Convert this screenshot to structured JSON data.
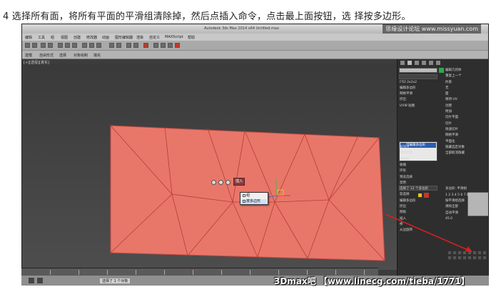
{
  "caption": "4 选择所有面，将所有平面的平滑组清除掉，然后点插入命令，点击最上面按钮，选 择按多边形。",
  "app": {
    "title": "Autodesk 3ds Max 2014 x64  Untitled.max",
    "watermark_top": "思缘设计论坛 www.missyuan.com",
    "watermark_bottom": "3Dmax吧 【www.linecg.com/tieba/1771】"
  },
  "menu": [
    "编辑",
    "工具",
    "组",
    "视图",
    "创建",
    "修改器",
    "动画",
    "图形编辑器",
    "渲染",
    "自定义",
    "MAXScript",
    "帮助"
  ],
  "ribbon": [
    "建模",
    "自由形式",
    "选择",
    "对象绘制",
    "填充"
  ],
  "ribbon2": [
    "多边形建模",
    "修改选择",
    "编辑",
    "几何体(全部)",
    "多边形",
    "循环",
    "三角剖分",
    "细分",
    "可见性",
    "对齐",
    "属性"
  ],
  "viewport_label": "[+][透视][真实]",
  "quad_menu": {
    "title": "插入",
    "items": [
      "组",
      "按多边形"
    ]
  },
  "panel": {
    "object_name": "Rectangle004",
    "modifier_list": "修改器列表",
    "stack_item": "可编辑多边形",
    "left_column": [
      "Rectangle004",
      "修改器列表",
      "FFD 2x2x2",
      "编辑多边形",
      "网格平滑",
      "挤出",
      "UVW 贴图",
      "",
      "可编辑多边形",
      "",
      "",
      "",
      "",
      "选择",
      "",
      "按顶点",
      "忽略背面",
      "按角度",
      "收缩",
      "扩大",
      "环形",
      "循环",
      "预览选择",
      "禁用",
      "子对象",
      "多个",
      "选择了 12 个多边形",
      "软选择",
      "编辑多边形",
      "插入顶点",
      "挤出",
      "倒角",
      "轮廓",
      "插入",
      "桥",
      "翻转",
      "从边旋转",
      "沿样条线挤出"
    ],
    "right_column": [
      "编辑几何体",
      "重复上一个",
      "约束",
      "无",
      "边",
      "面",
      "法线",
      "保持 UV",
      "创建",
      "塌陷",
      "附加",
      "分离",
      "切片平面",
      "分割",
      "切片",
      "重置平面",
      "快速切片",
      "切割",
      "网格平滑",
      "细化",
      "平面化",
      "X Y Z",
      "视图对齐",
      "栅格对齐",
      "松弛",
      "隐藏选定对象",
      "全部取消隐藏",
      "隐藏未选定对象",
      "命名选择",
      "复制",
      "粘贴",
      "删除孤立顶点",
      "完全交互",
      "多边形: 平滑组",
      "1 2 3 4 5 6 7 8",
      "按平滑组选择",
      "清除全部",
      "自动平滑",
      "45.0"
    ]
  },
  "status": {
    "selection": "选择了 1 个对象",
    "frame": "0 / 100"
  }
}
